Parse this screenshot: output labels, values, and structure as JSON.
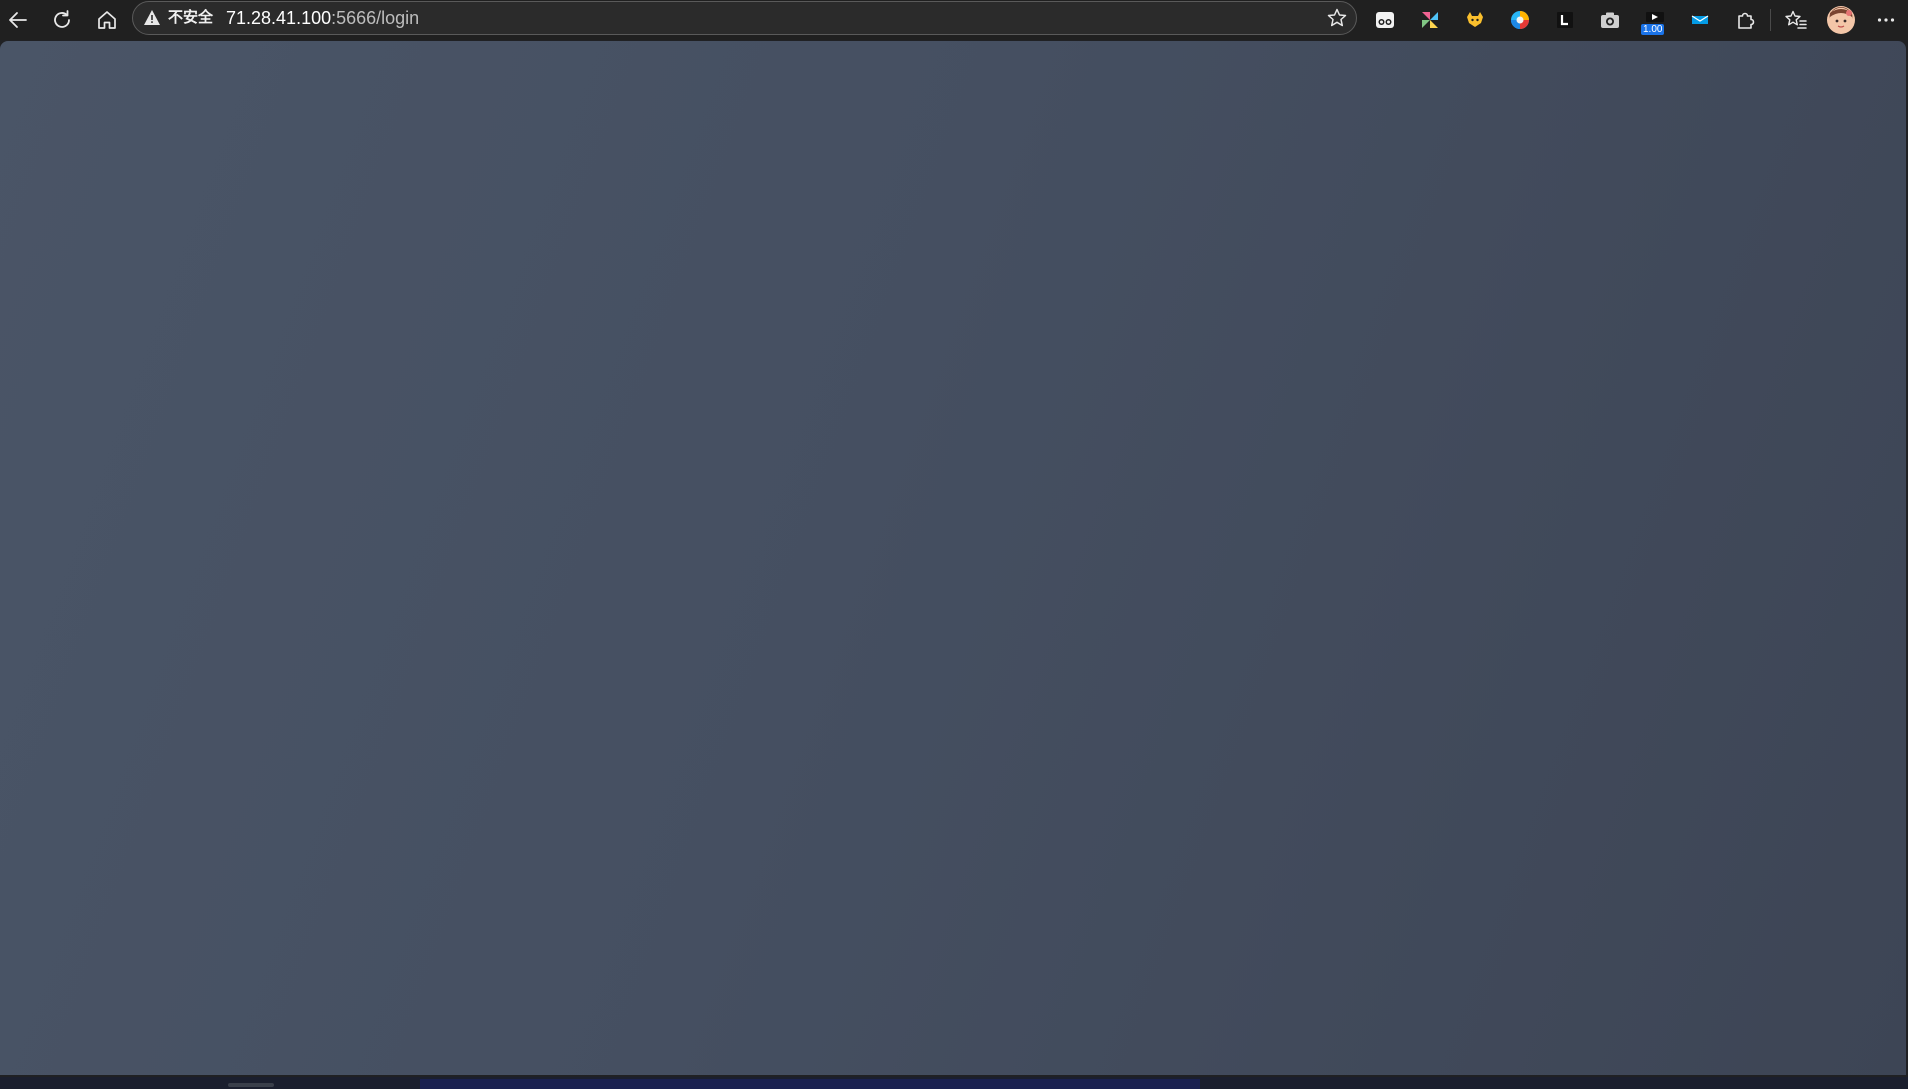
{
  "browser": {
    "security_label": "不安全",
    "url_host": "71.28.41.100",
    "url_path": ":5666/login",
    "nav_icons": [
      "back-arrow-icon",
      "refresh-icon",
      "home-icon"
    ],
    "extensions": [
      {
        "name": "reader-glasses-icon"
      },
      {
        "name": "pinwheel-icon"
      },
      {
        "name": "yellow-fox-icon"
      },
      {
        "name": "colorful-circle-icon"
      },
      {
        "name": "black-letter-l-icon"
      },
      {
        "name": "camera-icon"
      },
      {
        "name": "speed-controller-icon",
        "badge": "1.00"
      },
      {
        "name": "blue-fish-icon"
      },
      {
        "name": "extensions-puzzle-icon"
      }
    ],
    "colors": {
      "toolbar_bg": "#202020",
      "content_gradient_start": "#4a5567",
      "content_gradient_end": "#3d4555",
      "accent": "#1a73e8"
    }
  }
}
